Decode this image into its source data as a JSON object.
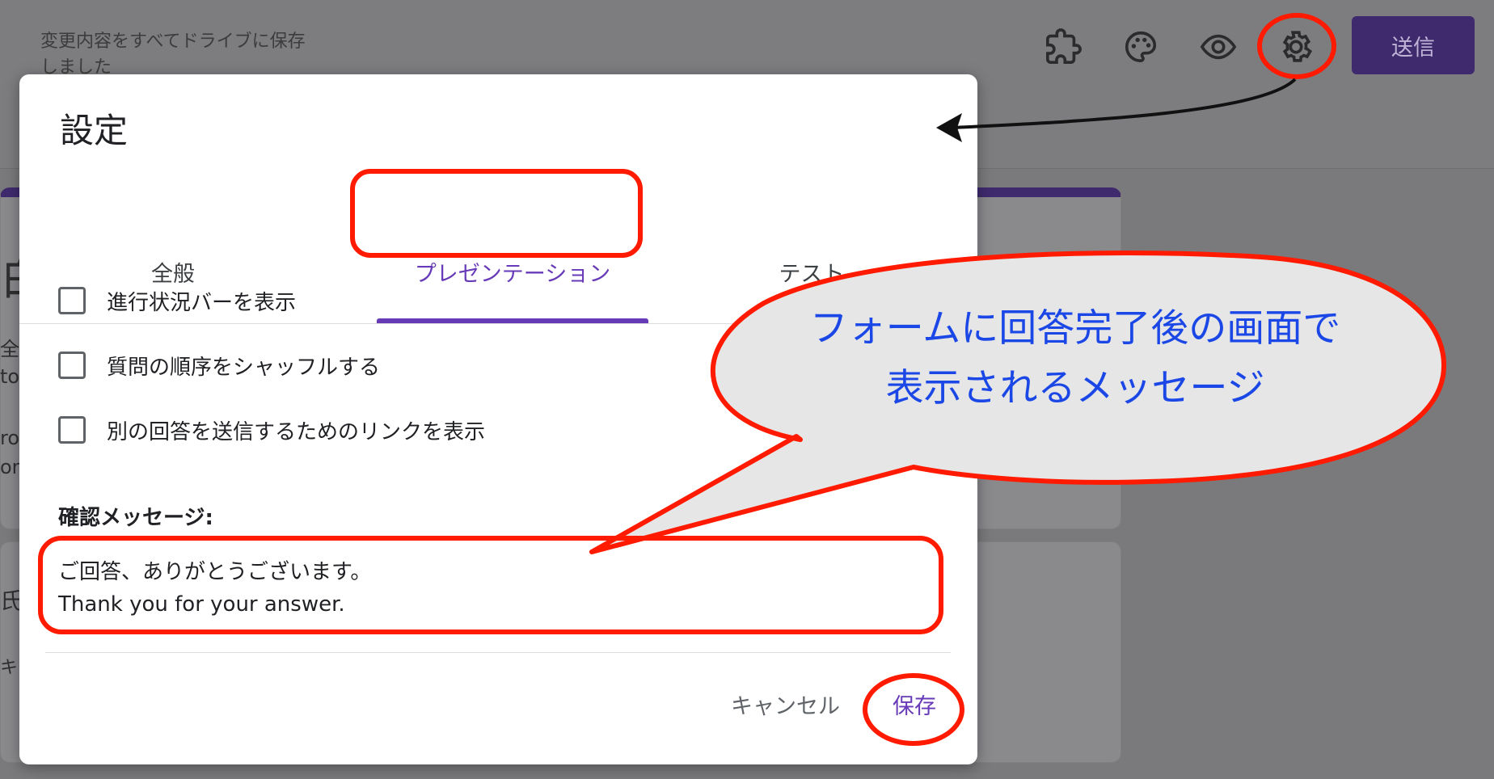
{
  "header": {
    "save_status": "変更内容をすべてドライブに保存しました",
    "send_label": "送信",
    "icons": [
      "addon-puzzle-icon",
      "palette-icon",
      "preview-eye-icon",
      "settings-gear-icon"
    ]
  },
  "background": {
    "frag1": "白",
    "frag2": "全員",
    "frag3": "to",
    "frag4": "ro",
    "frag5": "on",
    "frag6": "氏",
    "frag7": "キ"
  },
  "dialog": {
    "title": "設定",
    "tabs": {
      "general": "全般",
      "presentation": "プレゼンテーション",
      "test": "テスト"
    },
    "options": [
      {
        "label": "進行状況バーを表示",
        "checked": false
      },
      {
        "label": "質問の順序をシャッフルする",
        "checked": false
      },
      {
        "label": "別の回答を送信するためのリンクを表示",
        "checked": false
      }
    ],
    "confirm_label": "確認メッセージ:",
    "confirm_line1": "ご回答、ありがとうございます。",
    "confirm_line2": "Thank you for your answer.",
    "cancel_label": "キャンセル",
    "save_label": "保存"
  },
  "annotation": {
    "bubble_line1": "フォームに回答完了後の画面で",
    "bubble_line2": "表示されるメッセージ",
    "highlight_color": "#ff1a00",
    "bubble_text_color": "#1a47e6"
  },
  "colors": {
    "accent": "#673ab7",
    "send_button_bg": "#3f2a6e"
  }
}
